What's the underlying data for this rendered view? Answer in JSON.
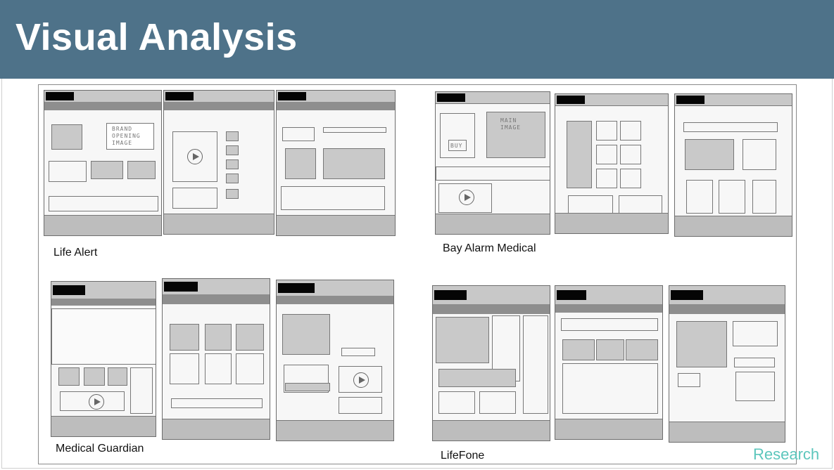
{
  "slide": {
    "title": "Visual Analysis",
    "footer_label": "Research",
    "accent_colors": {
      "header_bar": "#4e7289",
      "footer_label": "#5cc6bc"
    }
  },
  "groups": [
    {
      "label": "Life Alert"
    },
    {
      "label": "Bay Alarm Medical"
    },
    {
      "label": "Medical Guardian"
    },
    {
      "label": "LifeFone"
    }
  ],
  "sketch_notes": {
    "brand_opening_image": "BRAND OPENING IMAGE",
    "main_image": "MAIN IMAGE",
    "buy": "BUY"
  }
}
